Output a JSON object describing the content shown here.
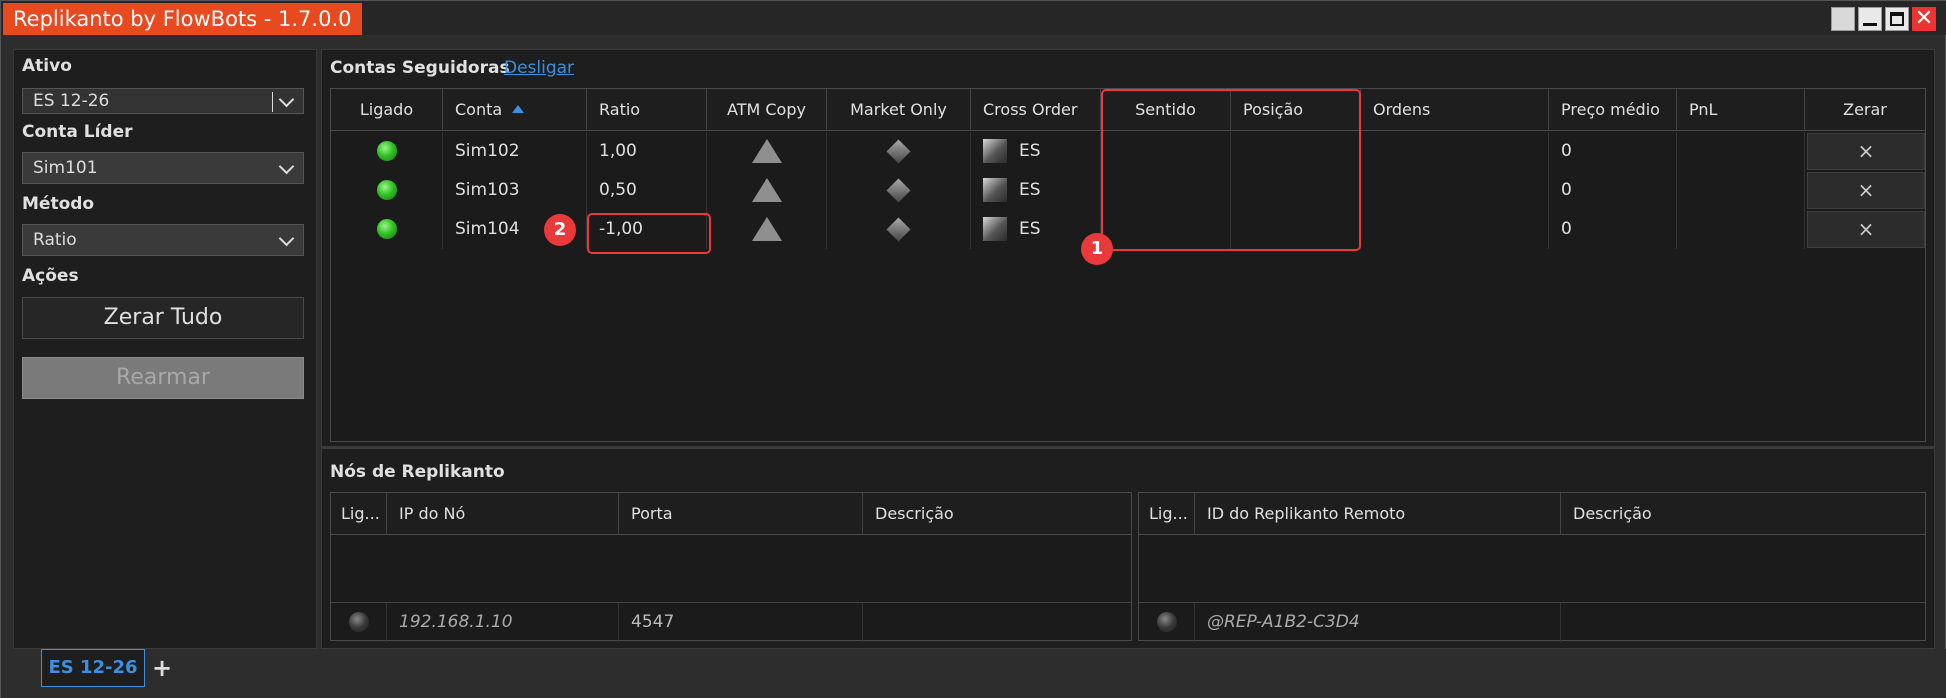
{
  "window": {
    "title": "Replikanto by FlowBots - 1.7.0.0"
  },
  "left": {
    "ativo_label": "Ativo",
    "ativo_value": "ES 12-26",
    "conta_lider_label": "Conta Líder",
    "conta_lider_value": "Sim101",
    "metodo_label": "Método",
    "metodo_value": "Ratio",
    "acoes_label": "Ações",
    "zerar_tudo": "Zerar Tudo",
    "rearmar": "Rearmar"
  },
  "seguidoras": {
    "title": "Contas Seguidoras",
    "desligar": "Desligar",
    "columns": [
      "Ligado",
      "Conta",
      "Ratio",
      "ATM Copy",
      "Market Only",
      "Cross Order",
      "Sentido",
      "Posição",
      "Ordens",
      "Preço médio",
      "PnL",
      "Zerar"
    ],
    "rows": [
      {
        "ligado": "on",
        "conta": "Sim102",
        "ratio": "1,00",
        "cross": "ES",
        "sentido": "",
        "posicao": "",
        "ordens": "",
        "preco": "0",
        "pnl": "",
        "zerar": "×"
      },
      {
        "ligado": "on",
        "conta": "Sim103",
        "ratio": "0,50",
        "cross": "ES",
        "sentido": "",
        "posicao": "",
        "ordens": "",
        "preco": "0",
        "pnl": "",
        "zerar": "×"
      },
      {
        "ligado": "on",
        "conta": "Sim104",
        "ratio": "-1,00",
        "cross": "ES",
        "sentido": "",
        "posicao": "",
        "ordens": "",
        "preco": "0",
        "pnl": "",
        "zerar": "×"
      }
    ],
    "annotations": {
      "badge1": "1",
      "badge2": "2"
    }
  },
  "nos": {
    "title": "Nós de Replikanto",
    "left_columns": [
      "Lig...",
      "IP do Nó",
      "Porta",
      "Descrição"
    ],
    "left_row": {
      "ip": "192.168.1.10",
      "porta": "4547",
      "descricao": ""
    },
    "right_columns": [
      "Lig...",
      "ID do Replikanto Remoto",
      "Descrição"
    ],
    "right_row": {
      "id": "@REP-A1B2-C3D4",
      "descricao": ""
    }
  },
  "tabs": {
    "active": "ES 12-26",
    "add": "+"
  },
  "colors": {
    "accent": "#3d8fe0",
    "title_bg": "#e8491f",
    "annotation": "#e83a3a",
    "led_on": "#31c224"
  }
}
